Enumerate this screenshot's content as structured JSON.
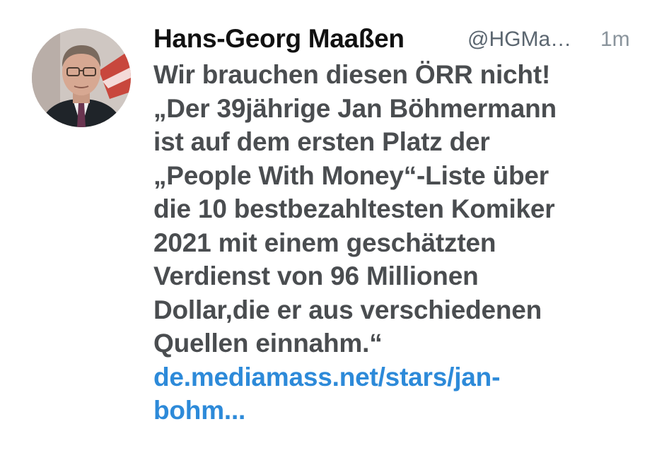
{
  "tweet": {
    "author_name": "Hans-Georg Maaßen",
    "handle": "@HGMa…",
    "time": "1m",
    "text": "Wir brauchen diesen ÖRR nicht!\n„Der 39jährige Jan Böhmermann\nist auf dem ersten Platz der\n„People With Money“-Liste über\ndie 10 bestbezahltesten Komiker\n2021 mit einem geschätzten\nVerdienst von 96 Millionen\nDollar,die er aus verschiedenen\nQuellen einnahm.“",
    "link_text": "de.mediamass.net/stars/jan-\nbohm...",
    "colors": {
      "name": "#111111",
      "body": "#4a4d50",
      "link": "#2d8ad9",
      "handle": "#5b6670",
      "time": "#8a949c"
    }
  }
}
